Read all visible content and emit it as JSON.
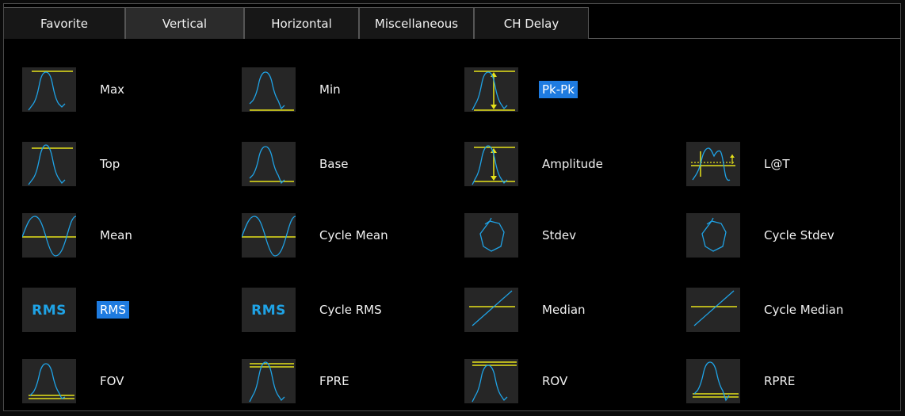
{
  "tabs": [
    {
      "label": "Favorite",
      "active": false
    },
    {
      "label": "Vertical",
      "active": true
    },
    {
      "label": "Horizontal",
      "active": false
    },
    {
      "label": "Miscellaneous",
      "active": false
    },
    {
      "label": "CH Delay",
      "active": false
    }
  ],
  "measurements": [
    {
      "label": "Max",
      "icon": "max-icon",
      "selected": false
    },
    {
      "label": "Min",
      "icon": "min-icon",
      "selected": false
    },
    {
      "label": "Pk-Pk",
      "icon": "pk-pk-icon",
      "selected": true
    },
    {
      "label": "Top",
      "icon": "top-icon",
      "selected": false
    },
    {
      "label": "Base",
      "icon": "base-icon",
      "selected": false
    },
    {
      "label": "Amplitude",
      "icon": "amplitude-icon",
      "selected": false
    },
    {
      "label": "L@T",
      "icon": "level-at-time-icon",
      "selected": false
    },
    {
      "label": "Mean",
      "icon": "mean-icon",
      "selected": false
    },
    {
      "label": "Cycle Mean",
      "icon": "cycle-mean-icon",
      "selected": false
    },
    {
      "label": "Stdev",
      "icon": "stdev-icon",
      "selected": false
    },
    {
      "label": "Cycle Stdev",
      "icon": "cycle-stdev-icon",
      "selected": false
    },
    {
      "label": "RMS",
      "icon": "rms-icon",
      "icon_text": "RMS",
      "selected": true
    },
    {
      "label": "Cycle RMS",
      "icon": "cycle-rms-icon",
      "icon_text": "RMS",
      "selected": false
    },
    {
      "label": "Median",
      "icon": "median-icon",
      "selected": false
    },
    {
      "label": "Cycle Median",
      "icon": "cycle-median-icon",
      "selected": false
    },
    {
      "label": "FOV",
      "icon": "fov-icon",
      "selected": false
    },
    {
      "label": "FPRE",
      "icon": "fpre-icon",
      "selected": false
    },
    {
      "label": "ROV",
      "icon": "rov-icon",
      "selected": false
    },
    {
      "label": "RPRE",
      "icon": "rpre-icon",
      "selected": false
    }
  ],
  "colors": {
    "waveform": "#1fa3e6",
    "marker": "#e6e21a",
    "selection": "#1e7be0",
    "icon_bg": "#262626"
  }
}
